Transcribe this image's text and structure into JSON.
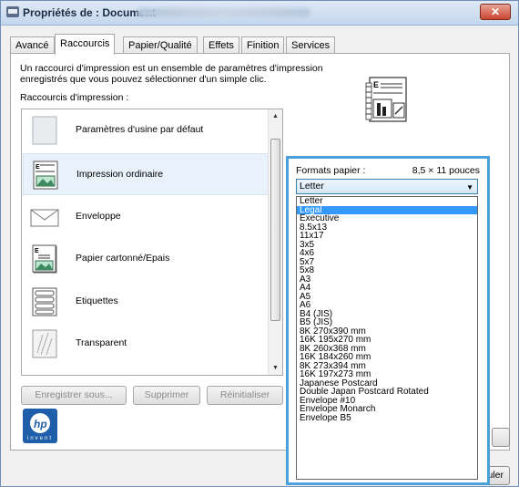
{
  "window": {
    "title": "Propriétés de : Document",
    "close_label": "✕"
  },
  "tabs": [
    {
      "label": "Avancé"
    },
    {
      "label": "Raccourcis"
    },
    {
      "label": "Papier/Qualité"
    },
    {
      "label": "Effets"
    },
    {
      "label": "Finition"
    },
    {
      "label": "Services"
    }
  ],
  "panel": {
    "description_line1": "Un raccourci d'impression est un ensemble de paramètres d'impression",
    "description_line2": "enregistrés que vous pouvez sélectionner d'un simple clic.",
    "shortcuts_label": "Raccourcis d'impression :"
  },
  "shortcuts": [
    {
      "label": "Paramètres d'usine par défaut",
      "icon": "blank-page-icon"
    },
    {
      "label": "Impression ordinaire",
      "icon": "document-icon"
    },
    {
      "label": "Enveloppe",
      "icon": "envelope-icon"
    },
    {
      "label": "Papier cartonné/Epais",
      "icon": "cardstock-icon"
    },
    {
      "label": "Etiquettes",
      "icon": "labels-icon"
    },
    {
      "label": "Transparent",
      "icon": "transparency-icon"
    }
  ],
  "buttons": {
    "save_as": "Enregistrer sous...",
    "delete": "Supprimer",
    "reset": "Réinitialiser",
    "apply_partial": "",
    "cancel_partial": "nuler"
  },
  "paper": {
    "formats_label": "Formats papier :",
    "size_value": "8,5 × 11 pouces",
    "selected": "Letter",
    "options": [
      "Letter",
      "Legal",
      "Executive",
      "8.5x13",
      "11x17",
      "3x5",
      "4x6",
      "5x7",
      "5x8",
      "A3",
      "A4",
      "A5",
      "A6",
      "B4 (JIS)",
      "B5 (JIS)",
      "8K 270x390 mm",
      "16K 195x270 mm",
      "8K 260x368 mm",
      "16K 184x260 mm",
      "8K 273x394 mm",
      "16K 197x273 mm",
      "Japanese Postcard",
      "Double Japan Postcard Rotated",
      "Envelope #10",
      "Envelope Monarch",
      "Envelope B5"
    ],
    "highlighted": "Legal"
  },
  "logo": {
    "text": "invent"
  },
  "colors": {
    "accent": "#4aa0d8",
    "selection": "#3399ff"
  }
}
